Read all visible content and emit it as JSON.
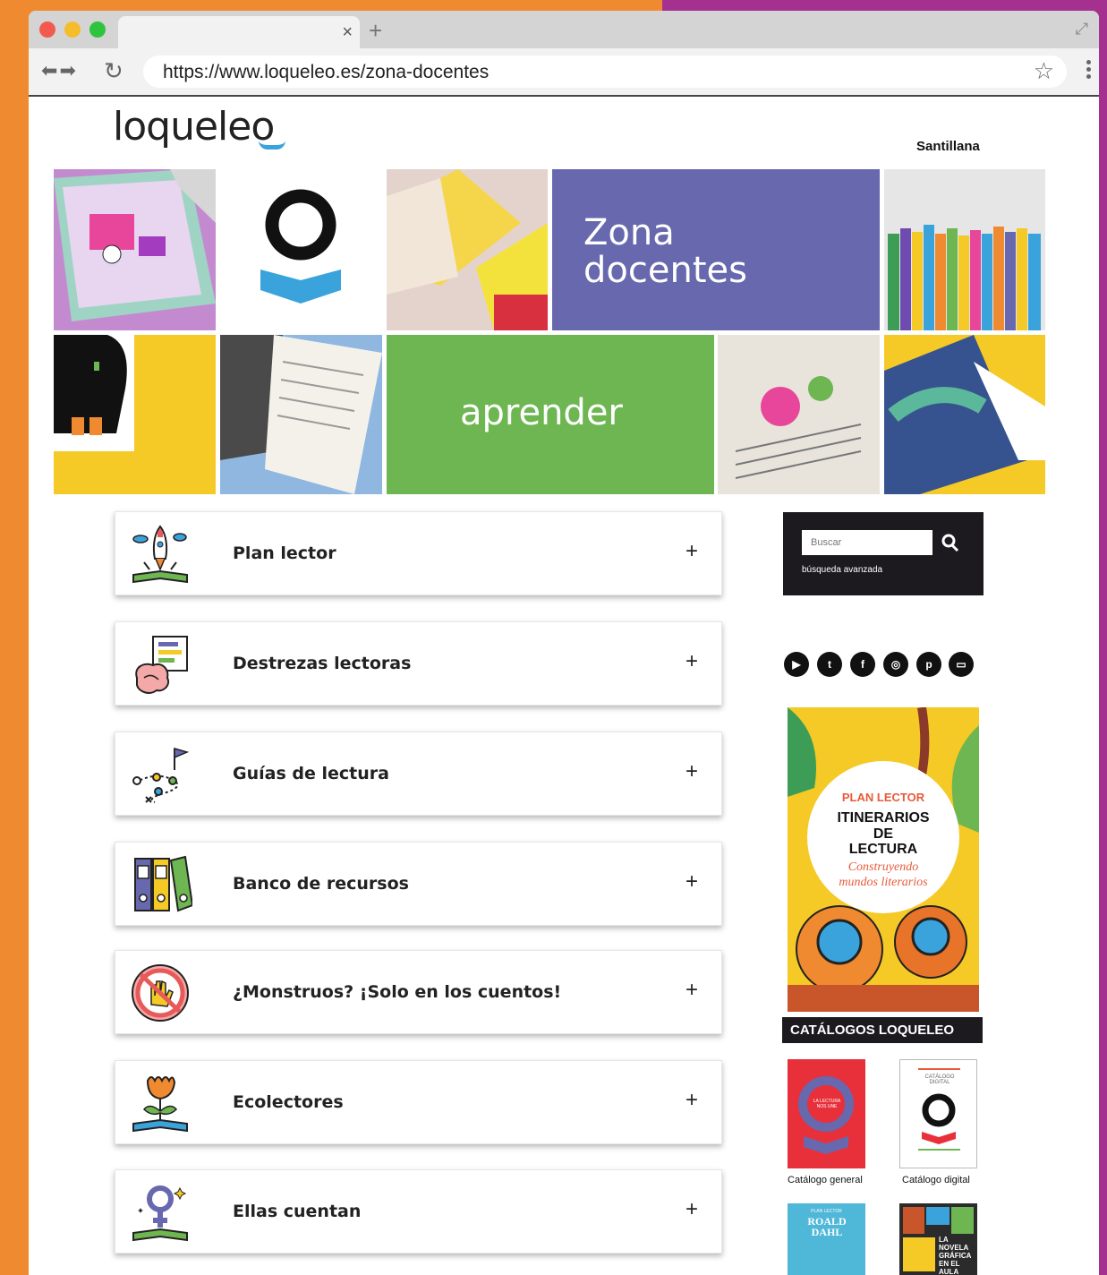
{
  "browser": {
    "url": "https://www.loqueleo.es/zona-docentes",
    "tab_close": "×",
    "new_tab": "+"
  },
  "header": {
    "logo": "loqueleo",
    "publisher": "Santillana"
  },
  "banner": {
    "zona_line1": "Zona",
    "zona_line2": "docentes",
    "aprender": "aprender",
    "colors": {
      "purple": "#6768ad",
      "green": "#6db651",
      "yellow": "#f5c926"
    }
  },
  "sections": [
    {
      "label": "Plan lector",
      "icon": "rocket-book-icon"
    },
    {
      "label": "Destrezas lectoras",
      "icon": "brain-document-icon"
    },
    {
      "label": "Guías de lectura",
      "icon": "route-map-icon"
    },
    {
      "label": "Banco de recursos",
      "icon": "binders-icon"
    },
    {
      "label": "¿Monstruos? ¡Solo en los cuentos!",
      "icon": "stop-hand-icon"
    },
    {
      "label": "Ecolectores",
      "icon": "flower-book-icon"
    },
    {
      "label": "Ellas cuentan",
      "icon": "female-symbol-book-icon"
    }
  ],
  "expand_symbol": "+",
  "search": {
    "placeholder": "Buscar",
    "advanced": "búsqueda avanzada"
  },
  "social": [
    "youtube-icon",
    "twitter-icon",
    "facebook-icon",
    "instagram-icon",
    "pinterest-icon",
    "tv-icon"
  ],
  "promo": {
    "kicker": "PLAN LECTOR",
    "line1": "ITINERARIOS",
    "line2": "DE",
    "line3": "LECTURA",
    "sub1": "Construyendo",
    "sub2": "mundos literarios"
  },
  "catalogs": {
    "title": "CATÁLOGOS LOQUELEO",
    "items": [
      {
        "caption": "Catálogo general",
        "cover_text": "LA LECTURA NOS UNE"
      },
      {
        "caption": "Catálogo digital",
        "cover_text": "CATÁLOGO DIGITAL"
      }
    ],
    "more": [
      {
        "cover_text": "ROALD DAHL",
        "kicker": "PLAN LECTOR"
      },
      {
        "cover_text": "LA NOVELA GRÁFICA EN EL AULA"
      }
    ]
  }
}
